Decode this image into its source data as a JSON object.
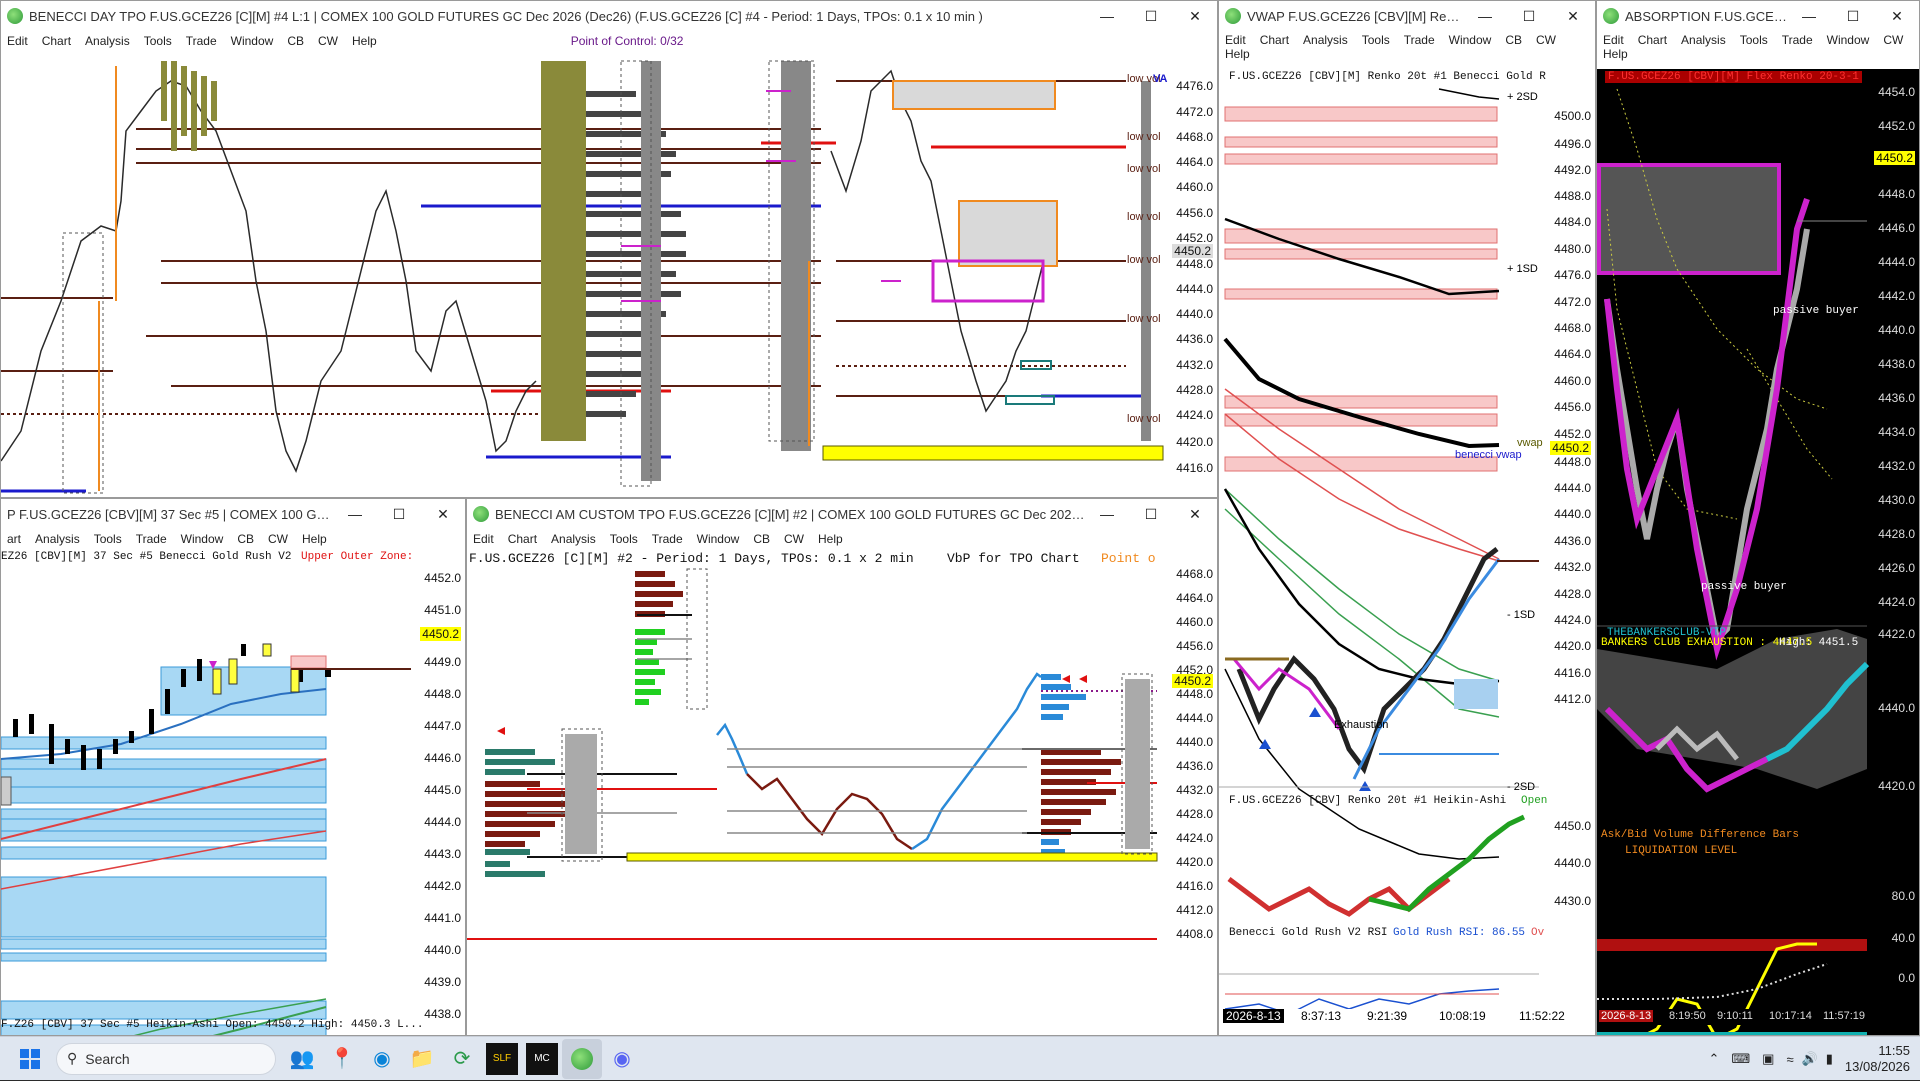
{
  "windows": {
    "day_tpo": {
      "title": "BENECCI DAY TPO F.US.GCEZ26 [C][M] #4 L:1 | COMEX 100 GOLD FUTURES GC Dec 2026 (Dec26) (F.US.GCEZ26 [C] #4 - Period: 1 Days, TPOs: 0.1 x 10 min )",
      "menu": [
        "Edit",
        "Chart",
        "Analysis",
        "Tools",
        "Trade",
        "Window",
        "CB",
        "CW",
        "Help"
      ],
      "poc_label": "Point of Control: 0/32",
      "axis": [
        "4476.0",
        "4472.0",
        "4468.0",
        "4464.0",
        "4460.0",
        "4456.0",
        "4452.0",
        "4450.2",
        "4448.0",
        "4444.0",
        "4440.0",
        "4436.0",
        "4432.0",
        "4428.0",
        "4424.0",
        "4420.0",
        "4416.0"
      ],
      "lowvol_labels": [
        "low vol",
        "low vol",
        "low vol",
        "low vol",
        "low vol",
        "low vol",
        "low vol"
      ],
      "va_label": "VA",
      "colors": {
        "accent_yellow": "#ffff00",
        "brown": "#5a1f12",
        "blue": "#1a1acc",
        "red": "#e01010",
        "olive": "#8a8a3a",
        "magenta": "#cc22cc",
        "orange": "#f08a20"
      }
    },
    "vwap": {
      "title": "VWAP F.US.GCEZ26 [CBV][M]  Renko ...",
      "menu": [
        "Edit",
        "Chart",
        "Analysis",
        "Tools",
        "Trade",
        "Window",
        "CB",
        "CW",
        "Help"
      ],
      "chart_title": "F.US.GCEZ26 [CBV][M]  Renko 20t #1 Benecci Gold R",
      "axis": [
        "4500.0",
        "4496.0",
        "4492.0",
        "4488.0",
        "4484.0",
        "4480.0",
        "4476.0",
        "4472.0",
        "4468.0",
        "4464.0",
        "4460.0",
        "4456.0",
        "4452.0",
        "4450.2",
        "4448.0",
        "4444.0",
        "4440.0",
        "4436.0",
        "4432.0",
        "4428.0",
        "4424.0",
        "4420.0",
        "4416.0",
        "4412.0"
      ],
      "labels": {
        "p2sd": "+ 2SD",
        "p1sd": "+ 1SD",
        "vwap": "vwap",
        "benecci_vwap": "benecci vwap",
        "m1sd": "- 1SD",
        "m2sd": "- 2SD",
        "exhaustion": "Exhaustion"
      },
      "sub_title": "F.US.GCEZ26 [CBV]  Renko 20t #1 Heikin-Ashi",
      "sub_open": "Open",
      "sub_axis": [
        "4450.0",
        "4440.0",
        "4430.0"
      ],
      "rsi_title": "Benecci Gold Rush V2 RSI",
      "rsi_value": "Gold Rush RSI: 86.55",
      "rsi_more": "Ov",
      "time_axis": [
        "2026-8-13",
        "8:37:13",
        "9:21:39",
        "10:08:19",
        "11:52:22"
      ]
    },
    "absorption": {
      "title": "ABSORPTION  F.US.GCEZ26...",
      "menu": [
        "Edit",
        "Chart",
        "Analysis",
        "Tools",
        "Trade",
        "Window",
        "CW",
        "Help"
      ],
      "chart_title": "F.US.GCEZ26 [CBV][M]  Flex Renko 20-3-1",
      "axis": [
        "4454.0",
        "4452.0",
        "4450.2",
        "4448.0",
        "4446.0",
        "4444.0",
        "4442.0",
        "4440.0",
        "4438.0",
        "4436.0",
        "4434.0",
        "4432.0",
        "4430.0",
        "4428.0",
        "4426.0",
        "4424.0",
        "4422.0"
      ],
      "labels": {
        "passive_buyer_1": "passive buyer",
        "passive_buyer_2": "passive buyer",
        "bankers": "THEBANKERSCLUB-VTP",
        "exhaustion": "BANKERS CLUB EXHAUSTION : 4447.5",
        "high": "High: 4451.5",
        "askbid": "Ask/Bid Volume Difference Bars",
        "liquidation": "LIQUIDATION LEVEL"
      },
      "sub_axis": [
        "4440.0",
        "4420.0"
      ],
      "osc_axis": [
        "80.0",
        "40.0",
        "0.0"
      ],
      "time_axis": [
        "2026-8-13",
        "8:19:50",
        "9:10:11",
        "10:17:14",
        "11:57:19"
      ]
    },
    "sec37": {
      "title": "P F.US.GCEZ26 [CBV][M]  37 Sec  #5 | COMEX 100 GOLD FUT...",
      "menu": [
        "art",
        "Analysis",
        "Tools",
        "Trade",
        "Window",
        "CB",
        "CW",
        "Help"
      ],
      "chart_title": "EZ26 [CBV][M]  37 Sec  #5 Benecci Gold Rush V2",
      "zone_label": "Upper Outer Zone:",
      "axis": [
        "4452.0",
        "4451.0",
        "4450.2",
        "4449.0",
        "4448.0",
        "4447.0",
        "4446.0",
        "4445.0",
        "4444.0",
        "4443.0",
        "4442.0",
        "4441.0",
        "4440.0",
        "4439.0",
        "4438.0"
      ],
      "footer": "F.Z26 [CBV]  37 Sec  #5 Heikin-Ashi  Open: 4450.2  High: 4450.3  L..."
    },
    "am_tpo": {
      "title": "BENECCI AM CUSTOM TPO F.US.GCEZ26 [C][M] #2 | COMEX 100 GOLD FUTURES GC Dec 2026 (Dec26) (F.US...",
      "menu": [
        "Edit",
        "Chart",
        "Analysis",
        "Tools",
        "Trade",
        "Window",
        "CB",
        "CW",
        "Help"
      ],
      "chart_title": "F.US.GCEZ26 [C][M] #2 - Period: 1 Days, TPOs: 0.1 x 2 min",
      "vbp_label": "VbP for TPO Chart",
      "poc_label": "Point o",
      "axis": [
        "4468.0",
        "4464.0",
        "4460.0",
        "4456.0",
        "4452.0",
        "4450.2",
        "4448.0",
        "4444.0",
        "4440.0",
        "4436.0",
        "4432.0",
        "4428.0",
        "4424.0",
        "4420.0",
        "4416.0",
        "4412.0",
        "4408.0"
      ]
    }
  },
  "taskbar": {
    "search_placeholder": "Search",
    "time": "11:55",
    "date": "13/08/2026",
    "apps": [
      "windows-start",
      "search",
      "widgets",
      "files",
      "edge",
      "folder",
      "sync",
      "slf",
      "mc",
      "globe",
      "discord"
    ]
  }
}
